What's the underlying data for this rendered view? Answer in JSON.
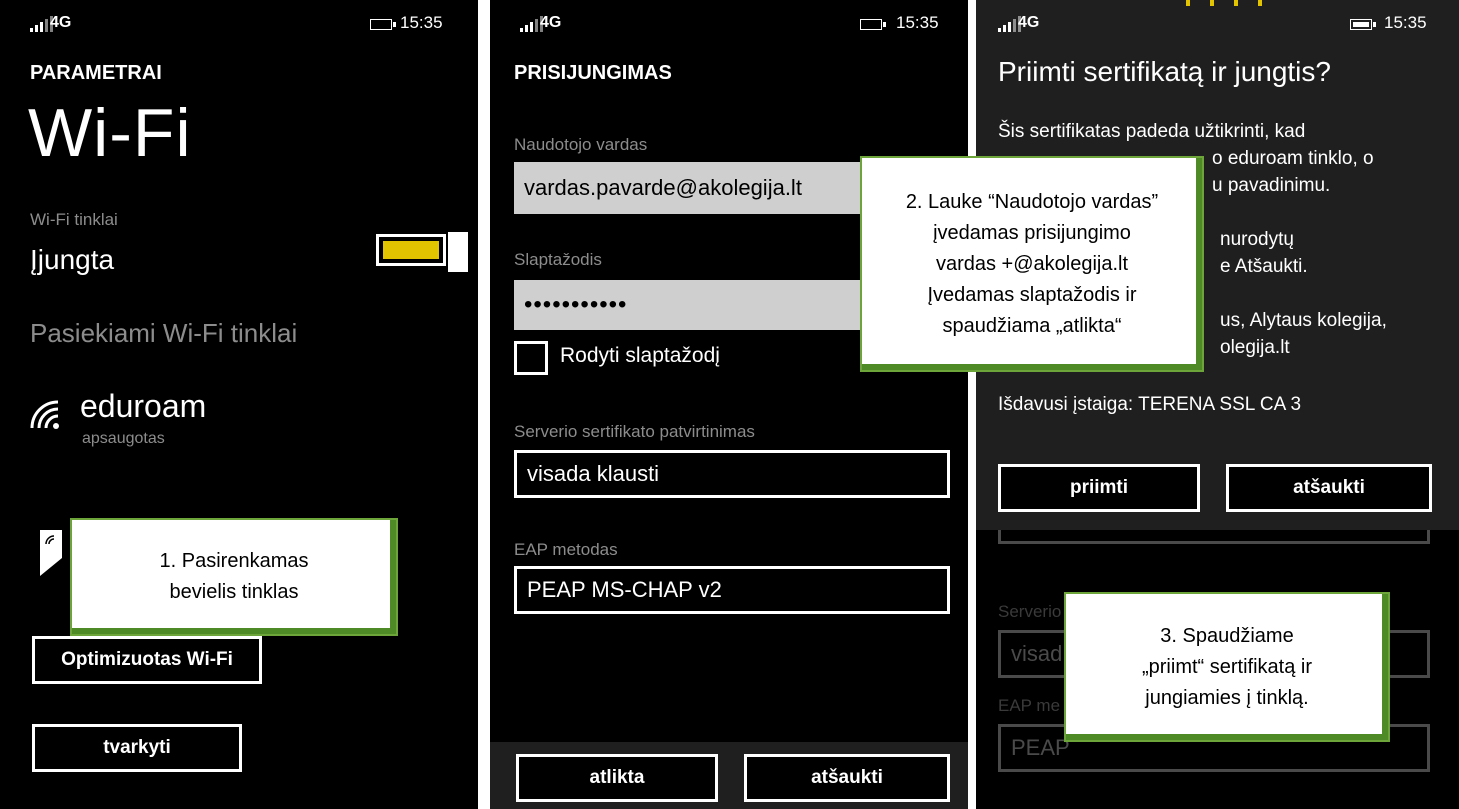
{
  "status": {
    "network": "4G",
    "time": "15:35"
  },
  "screen1": {
    "section": "PARAMETRAI",
    "title": "Wi-Fi",
    "networks_label": "Wi-Fi tinklai",
    "networks_state": "Įjungta",
    "available_label": "Pasiekiami Wi-Fi tinklai",
    "network_name": "eduroam",
    "network_status": "apsaugotas",
    "optimize_button": "Optimizuotas Wi-Fi",
    "manage_button": "tvarkyti",
    "toggle_color": "#e3c400"
  },
  "screen2": {
    "section": "PRISIJUNGIMAS",
    "username_label": "Naudotojo vardas",
    "username_value": "vardas.pavarde@akolegija.lt",
    "password_label": "Slaptažodis",
    "password_value": "•••••••••••",
    "show_password_label": "Rodyti slaptažodį",
    "cert_label": "Serverio sertifikato patvirtinimas",
    "cert_value": "visada klausti",
    "eap_label": "EAP metodas",
    "eap_value": "PEAP MS-CHAP v2",
    "done_button": "atlikta",
    "cancel_button": "atšaukti"
  },
  "screen3": {
    "dialog_title": "Priimti sertifikatą ir jungtis?",
    "line1": "Šis sertifikatas padeda užtikrinti, kad",
    "line2": "o eduroam tinklo, o",
    "line3": "u pavadinimu.",
    "line4": "nurodytų",
    "line5": "e Atšaukti.",
    "line6": "us, Alytaus kolegija,",
    "line7": "olegija.lt",
    "issuer": "Išdavusi įstaiga: TERENA SSL CA 3",
    "accept_button": "priimti",
    "cancel_button": "atšaukti",
    "bg_cert_label": "Serverio sertifikato patvirtinimas",
    "bg_cert_value": "visad",
    "bg_eap_label": "EAP me",
    "bg_eap_value": "PEAP"
  },
  "callouts": {
    "c1_line1": "1. Pasirenkamas",
    "c1_line2": "bevielis tinklas",
    "c2_line1": "2. Lauke “Naudotojo vardas”",
    "c2_line2": "įvedamas prisijungimo",
    "c2_line3": "vardas +@akolegija.lt",
    "c2_line4": "Įvedamas slaptažodis ir",
    "c2_line5": "spaudžiama „atlikta“",
    "c3_line1": "3. Spaudžiame",
    "c3_line2": "„priimt“ sertifikatą ir",
    "c3_line3": "jungiamies į tinklą."
  }
}
